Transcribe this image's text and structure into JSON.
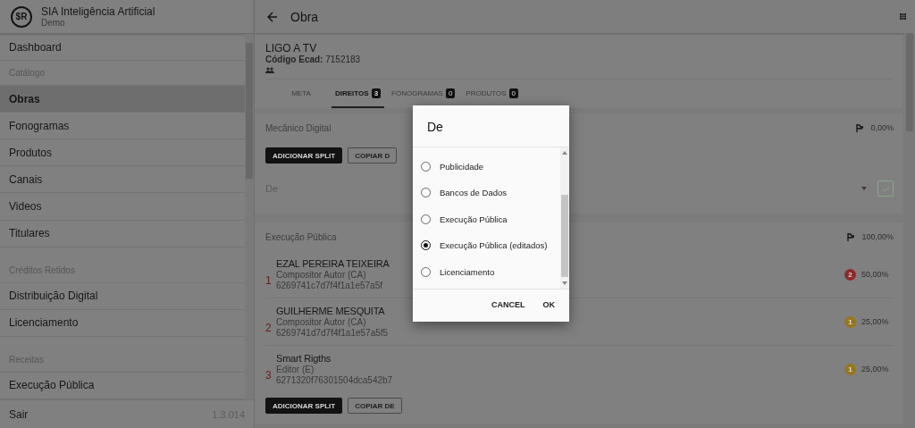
{
  "app": {
    "logo": "$R",
    "title": "SIA Inteligência Artificial",
    "subtitle": "Demo"
  },
  "sidebar": {
    "items": [
      {
        "kind": "item",
        "label": "Dashboard",
        "selected": false
      },
      {
        "kind": "header",
        "label": "Catálogo"
      },
      {
        "kind": "item",
        "label": "Obras",
        "selected": true
      },
      {
        "kind": "item",
        "label": "Fonogramas",
        "selected": false
      },
      {
        "kind": "item",
        "label": "Produtos",
        "selected": false
      },
      {
        "kind": "item",
        "label": "Canais",
        "selected": false
      },
      {
        "kind": "item",
        "label": "Videos",
        "selected": false
      },
      {
        "kind": "item",
        "label": "Titulares",
        "selected": false
      },
      {
        "kind": "header",
        "label": "Créditos Retidos"
      },
      {
        "kind": "item",
        "label": "Distribuição Digital",
        "selected": false
      },
      {
        "kind": "item",
        "label": "Licenciamento",
        "selected": false
      },
      {
        "kind": "header",
        "label": "Receitas"
      },
      {
        "kind": "item",
        "label": "Execução Pública",
        "selected": false
      }
    ],
    "footer": {
      "label": "Sair",
      "version": "1.3.014"
    }
  },
  "header": {
    "title": "Obra"
  },
  "work": {
    "title": "LIGO A TV",
    "code": "**Código Ecad:** 7152183"
  },
  "tabs": [
    {
      "label": "META",
      "selected": false
    },
    {
      "label": "DIREITOS",
      "count": "3",
      "selected": true
    },
    {
      "label": "FONOGRAMAS",
      "count": "0",
      "selected": false
    },
    {
      "label": "PRODUTOS",
      "count": "0",
      "selected": false
    }
  ],
  "sections": [
    {
      "title": "Mecânico Digital",
      "total": "0,00%",
      "buttons": [
        "ADICIONAR SPLIT",
        "COPIAR D"
      ],
      "select": {
        "label": "De"
      }
    },
    {
      "title": "Execução Pública",
      "total": "100,00%",
      "rows": [
        {
          "index": "1",
          "name": "EZAL PEREIRA TEIXEIRA",
          "role": "Compositor Autor (CA)",
          "id": "6269741c7d7f4f1a1e57a5f",
          "badge": "2",
          "color": "#8e2a2a",
          "share": "50,00%"
        },
        {
          "index": "2",
          "name": "GUILHERME MESQUITA",
          "role": "Compositor Autor (CA)",
          "id": "6269741d7d7f4f1a1e57a5f5",
          "badge": "1",
          "color": "#97761f",
          "share": "25,00%"
        },
        {
          "index": "3",
          "name": "Smart Rigths",
          "role": "Editor (E)",
          "id": "6271320f76301504dca542b7",
          "badge": "1",
          "color": "#97761f",
          "share": "25,00%"
        }
      ],
      "buttons": [
        "ADICIONAR SPLIT",
        "COPIAR DE"
      ]
    }
  ],
  "dialog": {
    "title": "De",
    "options": [
      {
        "label": "Publicidade",
        "selected": false
      },
      {
        "label": "Bancos de Dados",
        "selected": false
      },
      {
        "label": "Execução Pública",
        "selected": false
      },
      {
        "label": "Execução Pública (editados)",
        "selected": true
      },
      {
        "label": "Licenciamento",
        "selected": false
      }
    ],
    "buttons": [
      "CANCEL",
      "OK"
    ]
  }
}
